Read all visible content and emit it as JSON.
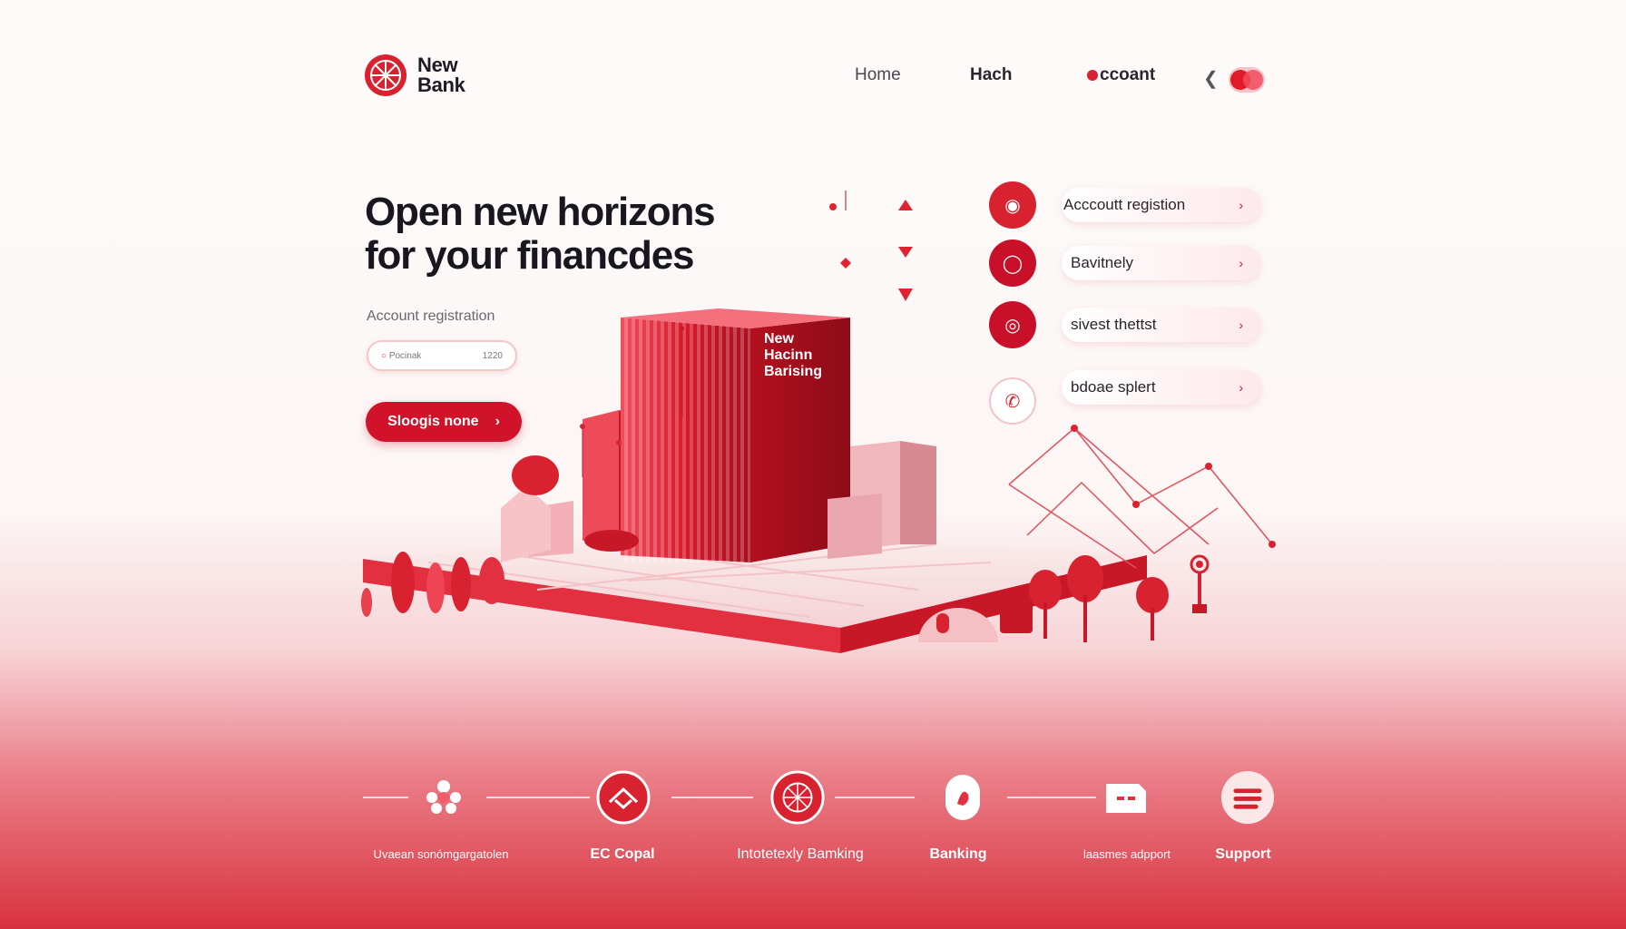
{
  "brand": {
    "name_line1": "New",
    "name_line2": "Bank",
    "accent": "#d0132a"
  },
  "nav": {
    "home": "Home",
    "hach": "Hach",
    "account": "ccoant",
    "back_icon": "chevron-left-icon"
  },
  "hero": {
    "headline_line1": "Open new horizons",
    "headline_line2": "for your  financdes",
    "reg_label": "Account registration",
    "input_placeholder": "Pocinak",
    "input_value": "1220",
    "cta_label": "Sloogis none",
    "cta_arrow": "›"
  },
  "building_sign": {
    "line1": "New",
    "line2": "Hacinn",
    "line3": "Barising"
  },
  "features": [
    {
      "label": "Acccoutt registion",
      "icon": "flame-icon"
    },
    {
      "label": "Bavitnely",
      "icon": "coin-icon"
    },
    {
      "label": "sivest thettst",
      "icon": "target-icon"
    },
    {
      "label": "bdoae splert",
      "icon": "phone-icon"
    }
  ],
  "feature_chevron": "›",
  "bottom": [
    {
      "label": "Uvaean sonómgargatolen",
      "icon": "network-dots-icon"
    },
    {
      "label": "EC Copal",
      "icon": "house-icon"
    },
    {
      "label": "Intotetexly Bamking",
      "icon": "globe-icon"
    },
    {
      "label": "Banking",
      "icon": "shield-icon"
    },
    {
      "label": "laasmes adpport",
      "icon": "card-icon"
    },
    {
      "label": "Support",
      "icon": "menu-icon"
    }
  ]
}
